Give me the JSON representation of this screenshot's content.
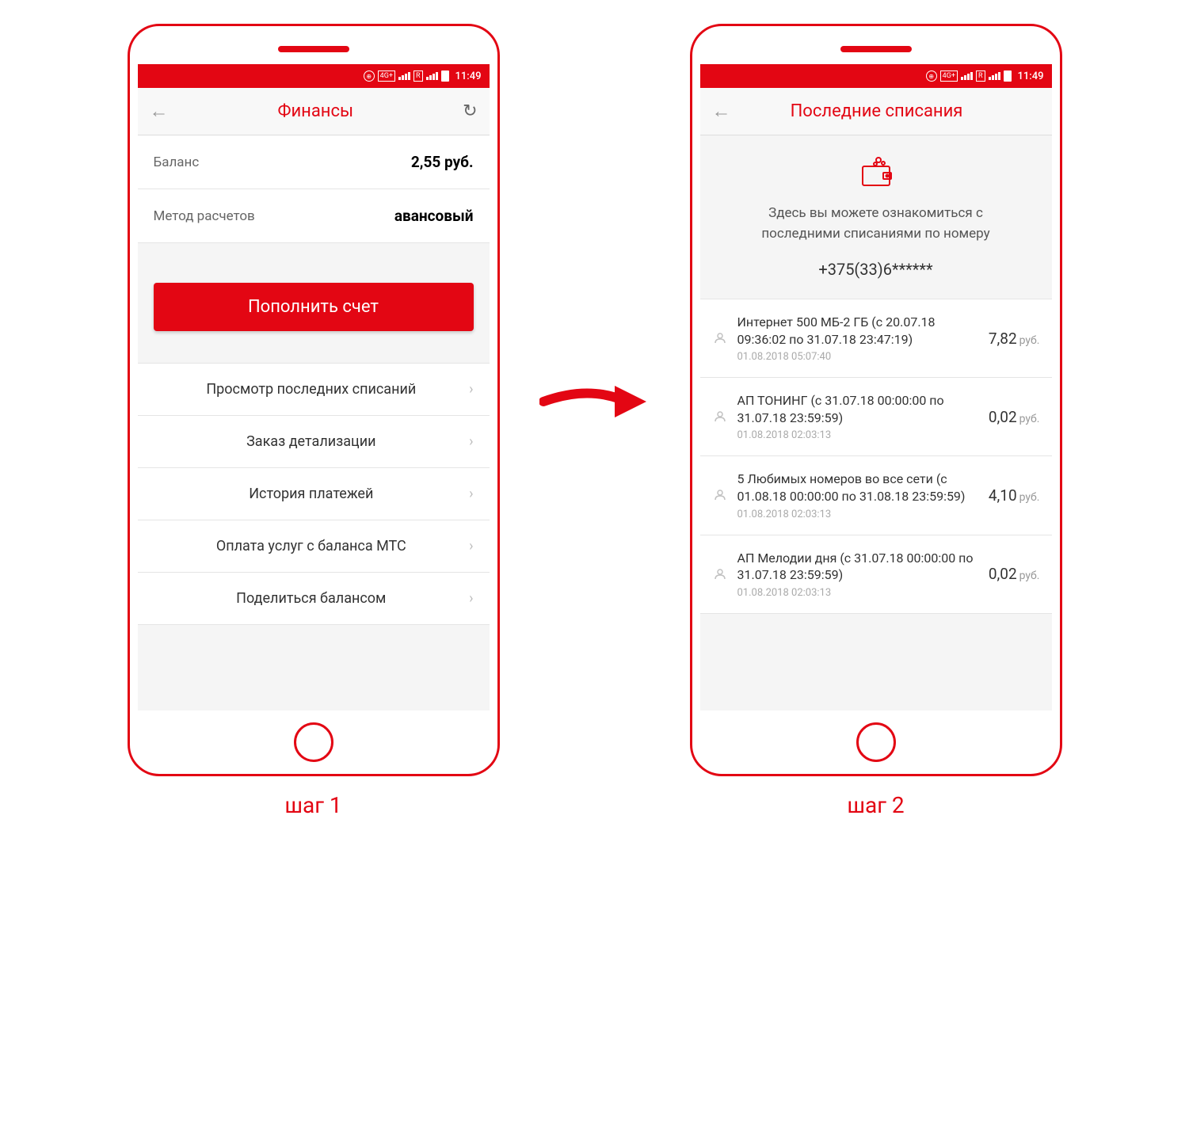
{
  "status": {
    "time": "11:49",
    "net": "4G+"
  },
  "screen1": {
    "title": "Финансы",
    "balance_label": "Баланс",
    "balance_value": "2,55 руб.",
    "method_label": "Метод расчетов",
    "method_value": "авансовый",
    "primary_button": "Пополнить счет",
    "menu": [
      "Просмотр последних списаний",
      "Заказ детализации",
      "История платежей",
      "Оплата услуг с баланса МТС",
      "Поделиться балансом"
    ]
  },
  "screen2": {
    "title": "Последние списания",
    "intro_line1": "Здесь вы можете ознакомиться с",
    "intro_line2": "последними списаниями по номеру",
    "phone": "+375(33)6******",
    "currency": "руб.",
    "charges": [
      {
        "title": "Интернет 500 МБ-2 ГБ (с 20.07.18 09:36:02 по 31.07.18 23:47:19)",
        "date": "01.08.2018 05:07:40",
        "amount": "7,82"
      },
      {
        "title": "АП ТОНИНГ (с 31.07.18 00:00:00 по 31.07.18 23:59:59)",
        "date": "01.08.2018 02:03:13",
        "amount": "0,02"
      },
      {
        "title": "5 Любимых номеров во все сети (с 01.08.18 00:00:00 по 31.08.18 23:59:59)",
        "date": "01.08.2018 02:03:13",
        "amount": "4,10"
      },
      {
        "title": "АП Мелодии дня (с 31.07.18 00:00:00 по 31.07.18 23:59:59)",
        "date": "01.08.2018 02:03:13",
        "amount": "0,02"
      }
    ]
  },
  "steps": {
    "step1": "шаг 1",
    "step2": "шаг 2"
  }
}
